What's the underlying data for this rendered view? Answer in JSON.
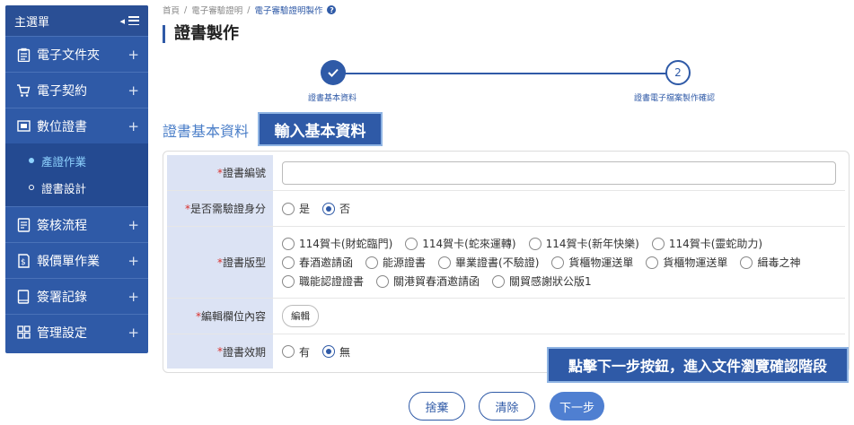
{
  "sidebar": {
    "title": "主選單",
    "items": [
      {
        "label": "電子文件夾",
        "icon": "clipboard-icon"
      },
      {
        "label": "電子契約",
        "icon": "cart-icon"
      },
      {
        "label": "數位證書",
        "icon": "certificate-icon"
      },
      {
        "label": "簽核流程",
        "icon": "document-icon"
      },
      {
        "label": "報價單作業",
        "icon": "invoice-icon"
      },
      {
        "label": "簽署記錄",
        "icon": "book-icon"
      },
      {
        "label": "管理設定",
        "icon": "grid-icon"
      }
    ],
    "subitems": [
      {
        "label": "產證作業",
        "active": true
      },
      {
        "label": "證書設計",
        "active": false
      }
    ],
    "plus": "+"
  },
  "breadcrumb": {
    "home": "首頁",
    "sep": "/",
    "level1": "電子審驗證明",
    "current": "電子審驗證明製作",
    "help": "?"
  },
  "page_title": "證書製作",
  "stepper": {
    "step1_label": "證書基本資料",
    "step2_number": "2",
    "step2_label": "證書電子檔案製作確認"
  },
  "section_title": "證書基本資料",
  "callouts": {
    "c1": "輸入基本資料",
    "c2": "點擊下一步按鈕，進入文件瀏覽確認階段"
  },
  "form": {
    "required_mark": "*",
    "cert_no_label": "證書編號",
    "cert_no_value": "",
    "verify_label": "是否需驗證身分",
    "verify_options": [
      "是",
      "否"
    ],
    "verify_selected": "否",
    "template_label": "證書版型",
    "template_options": [
      [
        "114賀卡(財蛇臨門)",
        "114賀卡(蛇來運轉)",
        "114賀卡(新年快樂)",
        "114賀卡(靈蛇助力)"
      ],
      [
        "春酒邀請函",
        "能源證書",
        "畢業證書(不驗證)",
        "貨櫃物運送單",
        "貨櫃物運送單",
        "緝毒之神"
      ],
      [
        "職能認證證書",
        "關港貿春酒邀請函",
        "關貿感謝狀公版1"
      ]
    ],
    "edit_label": "編輯欄位內容",
    "edit_button": "編輯",
    "validity_label": "證書效期",
    "validity_options": [
      "有",
      "無"
    ],
    "validity_selected": "無"
  },
  "buttons": {
    "discard": "捨棄",
    "clear": "清除",
    "next": "下一步"
  },
  "colors": {
    "primary": "#2f5aa7",
    "label_bg": "#dce3f4",
    "required": "#d9302c",
    "active_sub": "#8fd3ff"
  }
}
